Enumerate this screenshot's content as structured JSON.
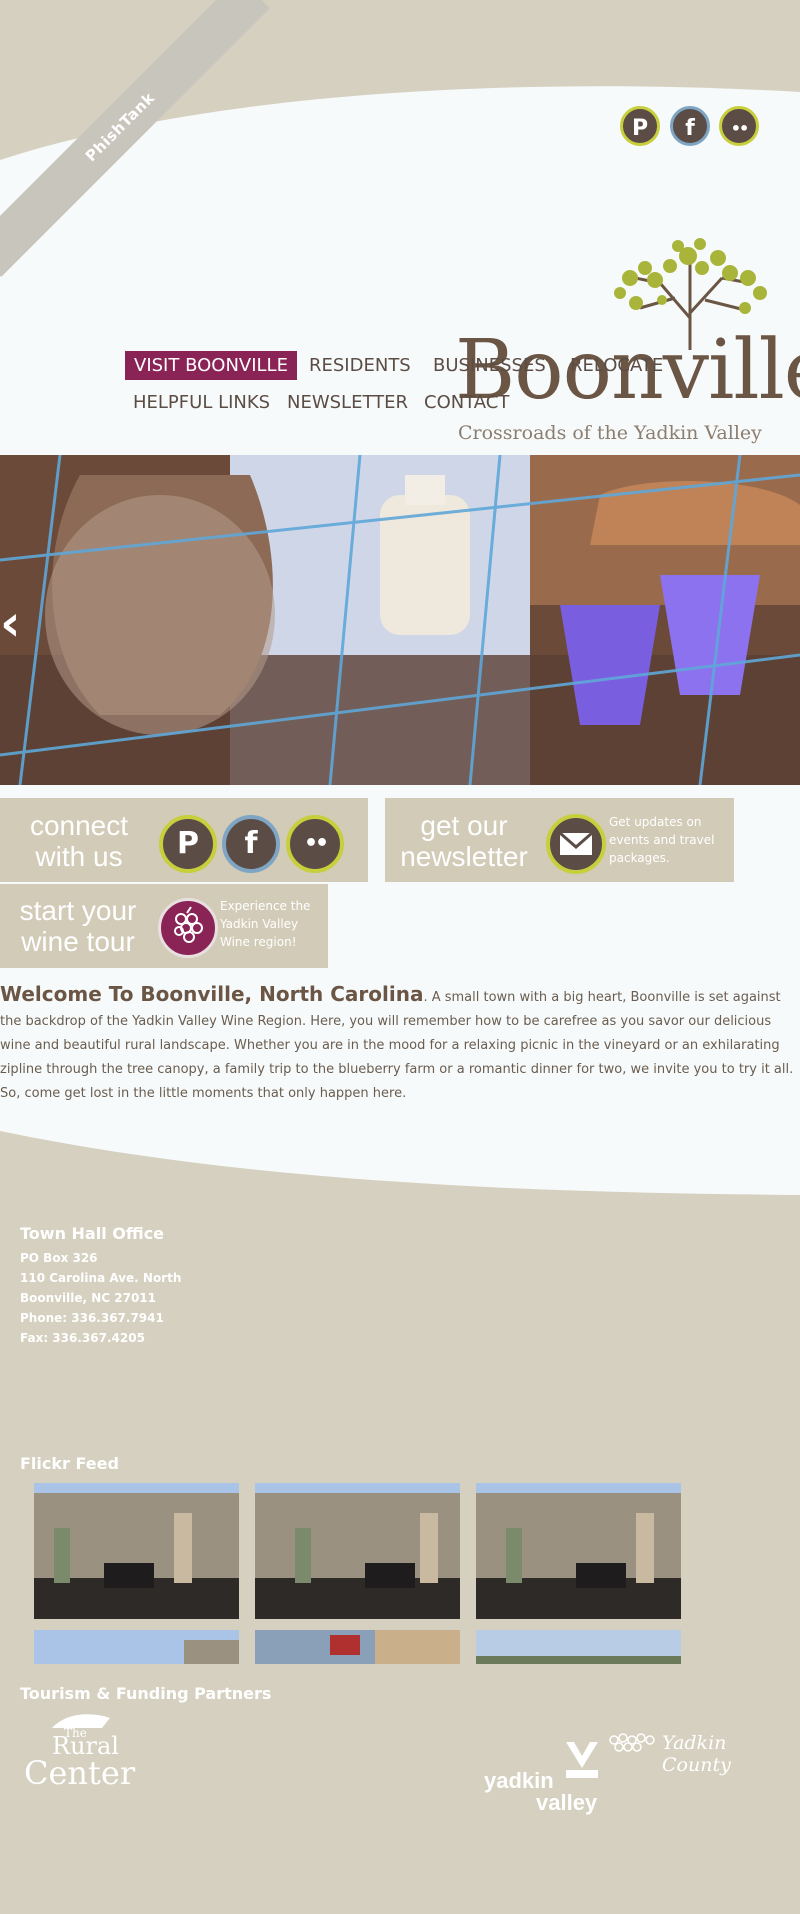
{
  "ribbon": {
    "label": "PhishTank"
  },
  "social": {
    "pinterest_glyph": "P",
    "facebook_glyph": "f",
    "flickr_glyph": "••"
  },
  "nav": {
    "items": [
      {
        "label": "VISIT BOONVILLE"
      },
      {
        "label": "RESIDENTS"
      },
      {
        "label": "BUSINESSES"
      },
      {
        "label": "RELOCATE"
      },
      {
        "label": "HELPFUL LINKS"
      },
      {
        "label": "NEWSLETTER"
      },
      {
        "label": "CONTACT"
      }
    ]
  },
  "logo": {
    "name": "Boonville",
    "tagline": "Crossroads of the Yadkin Valley"
  },
  "hero": {
    "prev_glyph": "‹"
  },
  "connect": {
    "line1": "connect",
    "line2": "with us"
  },
  "newsletter": {
    "line1": "get our",
    "line2": "newsletter",
    "text": "Get updates on events and travel packages."
  },
  "wine": {
    "line1": "start your",
    "line2": "wine tour",
    "text": "Experience the Yadkin Valley Wine region!"
  },
  "welcome": {
    "heading": "Welcome To Boonville, North Carolina",
    "body": ". A small town with a big heart, Boonville is set against the backdrop of the Yadkin Valley Wine Region. Here, you will remember how to be carefree as you savor our delicious wine and beautiful rural landscape. Whether you are in the mood for a relaxing picnic in the vineyard or an exhilarating zipline through the tree canopy, a family trip to the blueberry farm or a romantic dinner for two, we invite you to try it all. So, come get lost in the little moments that only happen here."
  },
  "footer": {
    "office_title": "Town Hall Office",
    "address": [
      "PO Box 326",
      "110 Carolina Ave. North",
      "Boonville, NC 27011",
      "Phone: 336.367.7941",
      "Fax: 336.367.4205"
    ],
    "flickr_title": "Flickr Feed",
    "partners_title": "Tourism & Funding Partners",
    "rural_center": {
      "line1": "The",
      "line2": "Rural",
      "line3": "Center"
    },
    "yadkin_valley": {
      "line1": "yadkin",
      "line2": "valley"
    },
    "yadkin_county": {
      "name": "Yadkin County"
    }
  },
  "colors": {
    "brand": "#8b2456",
    "brown": "#5b4d45",
    "tan": "#d2cbb8",
    "olive": "#a8b53a"
  }
}
